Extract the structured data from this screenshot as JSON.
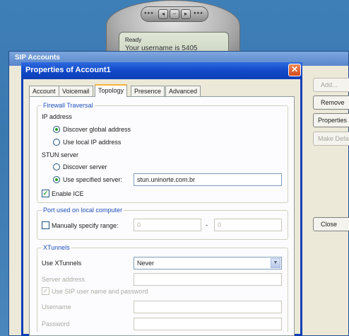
{
  "phone": {
    "status": "Ready",
    "message": "Your username is 5405"
  },
  "bg_window": {
    "title": "SIP Accounts",
    "buttons": {
      "add": "Add...",
      "remove": "Remove",
      "properties": "Properties",
      "make_default": "Make Default",
      "close": "Close"
    }
  },
  "dialog": {
    "title": "Properties of Account1",
    "close_glyph": "✕",
    "tabs": [
      "Account",
      "Voicemail",
      "Topology",
      "Presence",
      "Advanced"
    ],
    "active_tab": "Topology",
    "firewall": {
      "group_title": "Firewall Traversal",
      "ip_label": "IP address",
      "ip_option_global": "Discover global address",
      "ip_option_local": "Use local IP address",
      "ip_selected": "Discover global address",
      "stun_label": "STUN server",
      "stun_option_discover": "Discover server",
      "stun_option_specified": "Use specified server:",
      "stun_selected": "Use specified server:",
      "stun_value": "stun.uninorte.com.br",
      "enable_ice_label": "Enable ICE",
      "enable_ice_checked": true
    },
    "ports": {
      "group_title": "Port used on local computer",
      "manual_label": "Manually specify range:",
      "manual_checked": false,
      "range_from": "0",
      "range_separator": "-",
      "range_to": "0"
    },
    "xtunnels": {
      "group_title": "XTunnels",
      "use_label": "Use XTunnels",
      "use_value": "Never",
      "server_address_label": "Server address",
      "server_address_value": "",
      "use_sip_credentials_label": "Use SIP user name and password",
      "use_sip_credentials_checked": true,
      "username_label": "Username",
      "username_value": "",
      "password_label": "Password",
      "password_value": ""
    }
  }
}
